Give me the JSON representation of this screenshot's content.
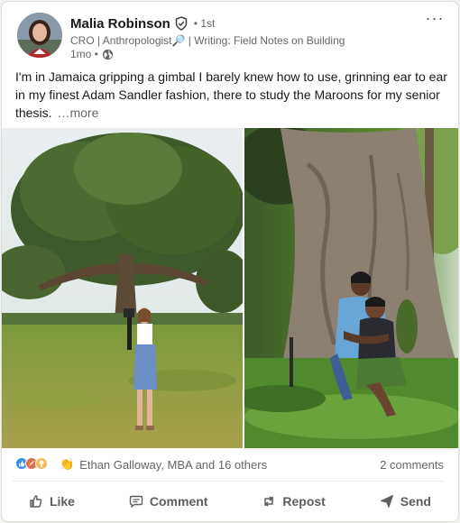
{
  "author": {
    "name": "Malia Robinson",
    "degree": "• 1st",
    "headline": "CRO | Anthropologist🔎 | Writing: Field Notes on Building",
    "time": "1mo •"
  },
  "post": {
    "text": "I'm in Jamaica gripping a gimbal I barely knew how to use, grinning ear to ear in my finest Adam Sandler fashion, there to study the Maroons for my senior thesis.",
    "see_more": "…more"
  },
  "social": {
    "reactors": "Ethan Galloway, MBA and 16 others",
    "comments": "2 comments"
  },
  "actions": {
    "like": "Like",
    "comment": "Comment",
    "repost": "Repost",
    "send": "Send"
  },
  "colors": {
    "like_blue": "#378fe9",
    "celebrate_red": "#df704d",
    "insight_yellow": "#f5bb5c",
    "action_gray": "#5e5e5e"
  },
  "icons": [
    "verified-icon",
    "globe-icon",
    "more-icon",
    "like-icon",
    "comment-icon",
    "repost-icon",
    "send-icon"
  ]
}
